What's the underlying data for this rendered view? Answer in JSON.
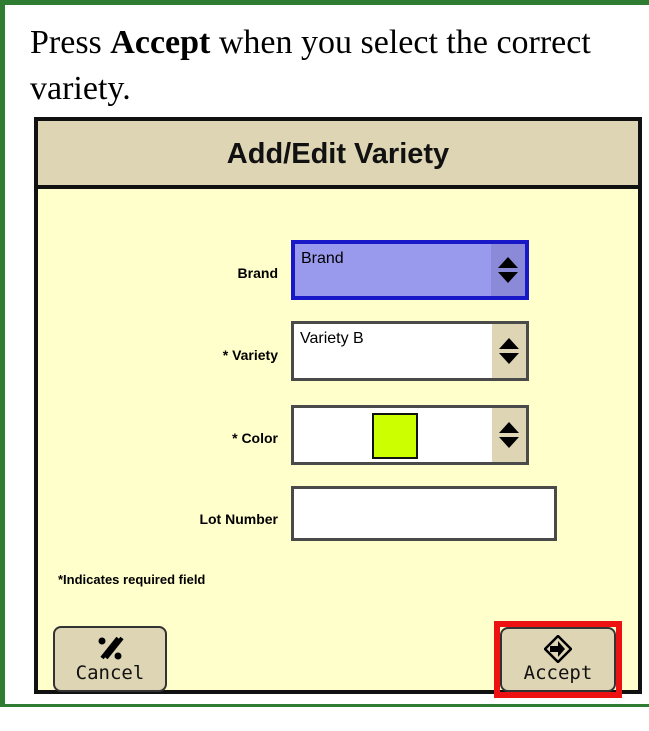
{
  "instruction": {
    "prefix": "Press ",
    "bold": "Accept",
    "suffix": " when you select the correct variety."
  },
  "dialog": {
    "title": "Add/Edit Variety",
    "fields": {
      "brand": {
        "label": "Brand",
        "value": "Brand"
      },
      "variety": {
        "label": "* Variety",
        "value": "Variety B"
      },
      "color": {
        "label": "* Color",
        "swatch": "#ccff00"
      },
      "lot_number": {
        "label": "Lot Number",
        "value": ""
      }
    },
    "required_note": "*Indicates required field",
    "buttons": {
      "cancel": {
        "label": "Cancel",
        "icon": "cancel-icon"
      },
      "accept": {
        "label": "Accept",
        "icon": "accept-arrow-icon"
      }
    }
  },
  "colors": {
    "dialog_bg": "#ffffcc",
    "title_bar": "#ddd5b4",
    "selected_field": "#9999ee",
    "highlight": "#ee1111"
  }
}
